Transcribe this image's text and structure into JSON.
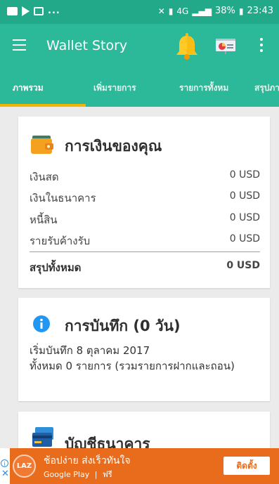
{
  "status_bar": {
    "left_dots": "...",
    "network": "4G",
    "battery": "38%",
    "time": "23:43"
  },
  "app_bar": {
    "title": "Wallet Story"
  },
  "tabs": [
    {
      "label": "ภาพรวม",
      "active": true
    },
    {
      "label": "เพิ่มรายการ",
      "active": false
    },
    {
      "label": "รายการทั้งหม",
      "active": false
    },
    {
      "label": "สรุปภา",
      "active": false
    }
  ],
  "money_card": {
    "title": "การเงินของคุณ",
    "rows": [
      {
        "label": "เงินสด",
        "value": "0 USD"
      },
      {
        "label": "เงินในธนาคาร",
        "value": "0 USD"
      },
      {
        "label": "หนี้สิน",
        "value": "0 USD"
      },
      {
        "label": "รายรับค้างรับ",
        "value": "0 USD"
      }
    ],
    "total_label": "สรุปทั้งหมด",
    "total_value": "0 USD"
  },
  "record_card": {
    "title": "การบันทึก (0 วัน)",
    "line1": "เริ่มบันทึก 8 ตุลาคม 2017",
    "line2": "ทั้งหมด 0 รายการ (รวมรายการฝากและถอน)"
  },
  "bank_card": {
    "title": "บัญชีธนาคาร"
  },
  "ad": {
    "logo_text": "LAZ",
    "headline": "ช้อปง่าย ส่งเร็วทันใจ",
    "store": "Google Play",
    "separator": "|",
    "price": "ฟรี",
    "install_label": "ติดตั้ง"
  },
  "colors": {
    "primary": "#2bb999",
    "status_bar": "#22a98a",
    "tab_indicator": "#f2b600",
    "ad_background": "#e96b1c",
    "info_blue": "#2196f3"
  }
}
